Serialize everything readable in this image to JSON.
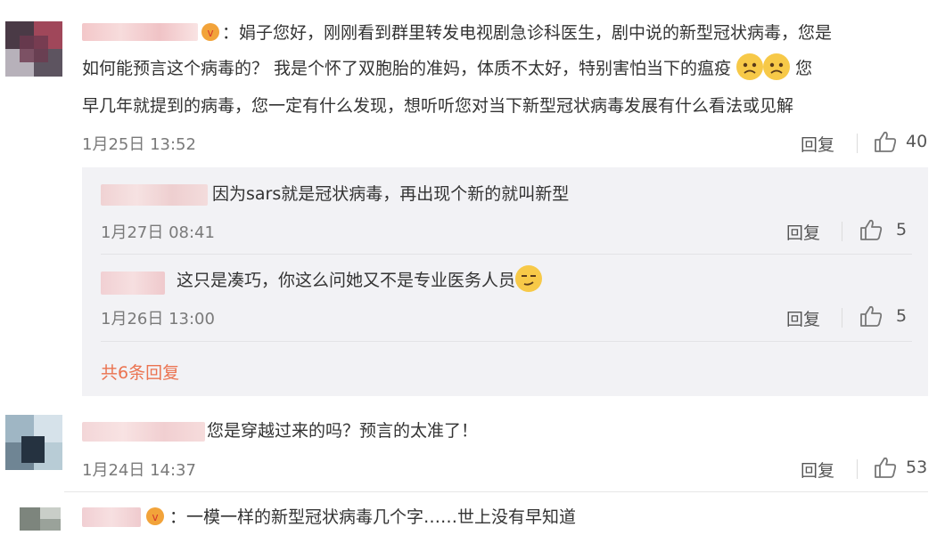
{
  "comments": [
    {
      "name": "",
      "text_lines": [
        "：娟子您好，刚刚看到群里转发电视剧急诊科医生，剧中说的新型冠状病毒，您是",
        "如何能预言这个病毒的？ 我是个怀了双胞胎的准妈，体质不太好，特别害怕当下的瘟疫",
        "早几年就提到的病毒，您一定有什么发现，想听听您对当下新型冠状病毒发展有什么看法或见解"
      ],
      "line2_suffix": "您",
      "time": "1月25日 13:52",
      "reply_label": "回复",
      "likes": "40"
    },
    {
      "name": "",
      "text": "您是穿越过来的吗？预言的太准了！",
      "time": "1月24日 14:37",
      "reply_label": "回复",
      "likes": "53"
    },
    {
      "name": "",
      "text": "：一模一样的新型冠状病毒几个字……世上没有早知道"
    }
  ],
  "replies": [
    {
      "name": "",
      "text": "因为sars就是冠状病毒，再出现个新的就叫新型",
      "time": "1月27日 08:41",
      "reply_label": "回复",
      "likes": "5"
    },
    {
      "name": "",
      "text": "这只是凑巧，你这么问她又不是专业医务人员",
      "time": "1月26日 13:00",
      "reply_label": "回复",
      "likes": "5"
    }
  ],
  "more_replies": "共6条回复",
  "colors": {
    "link": "#eb7350",
    "emoji_yellow": "#f7c948",
    "reply_bg": "#f2f2f5"
  }
}
